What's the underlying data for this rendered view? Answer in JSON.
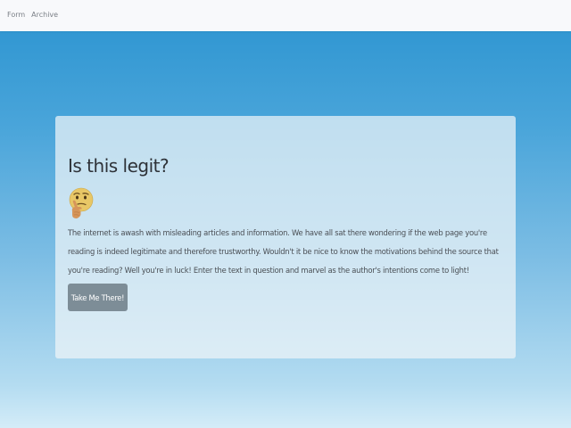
{
  "nav": {
    "items": [
      {
        "label": "Form"
      },
      {
        "label": "Archive"
      }
    ]
  },
  "main": {
    "title": "Is this legit?",
    "emoji_icon": "thinking-face-icon",
    "description": "The internet is awash with misleading articles and information. We have all sat there wondering if the web page you're reading is indeed legitimate and therefore trustworthy. Wouldn't it be nice to know the motivations behind the source that you're reading? Well you're in luck! Enter the text in question and marvel as the author's intentions come to light!",
    "button_label": "Take Me There!"
  },
  "colors": {
    "background_top": "#2a93d0",
    "background_bottom": "#d4ecf8",
    "navbar": "#f8f9fb",
    "button": "#7d8d97",
    "title_text": "#2e3238"
  }
}
